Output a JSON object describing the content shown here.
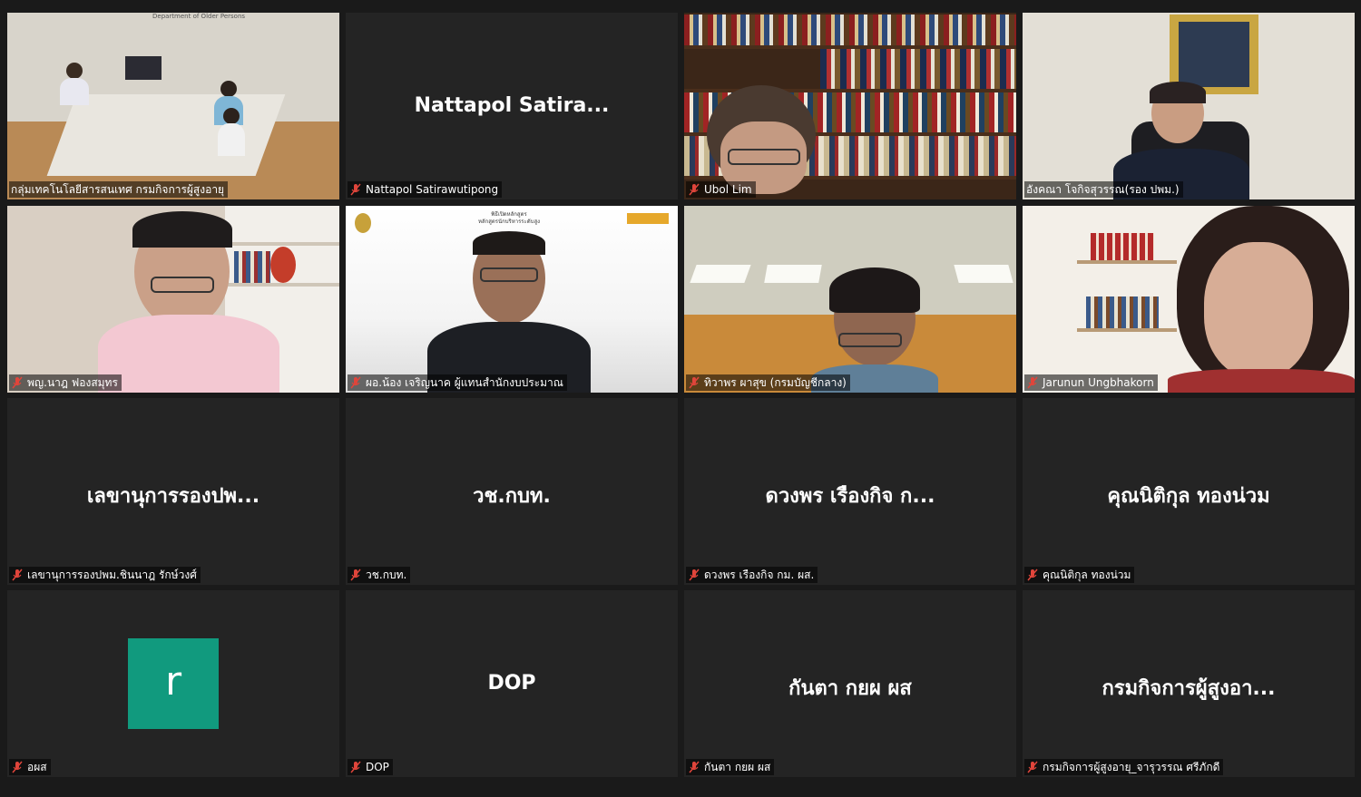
{
  "tiles": [
    {
      "name": "Video feed",
      "label": "กลุ่มเทคโนโลยีสารสนเทศ กรมกิจการผู้สูงอายุ",
      "type": "video",
      "scene": "meeting-room",
      "active": true,
      "caption_text": "Department of Older Persons"
    },
    {
      "name": "Nattapol  Satira...",
      "label": "Nattapol Satirawutipong",
      "type": "name"
    },
    {
      "name": "Video feed",
      "label": "Ubol Lim",
      "type": "video",
      "scene": "bookshelf"
    },
    {
      "name": "Video feed",
      "label": "อังคณา โจกิจสุวรรณ(รอง ปพม.)",
      "type": "video",
      "scene": "portrait-office"
    },
    {
      "name": "Video feed",
      "label": "พญ.นาฎ ฟองสมุทร",
      "type": "video",
      "scene": "home-shelf"
    },
    {
      "name": "Video feed",
      "label": "ผอ.น้อง เจริญนาค ผู้แทนสำนักงบประมาณ",
      "type": "video",
      "scene": "banner",
      "banner_text": [
        "พิธีเปิดหลักสูตร",
        "หลักสูตรนักบริหารระดับสูง"
      ]
    },
    {
      "name": "Video feed",
      "label": "ทิวาพร ผาสุข (กรมบัญชีกลาง)",
      "type": "video",
      "scene": "office-ceiling"
    },
    {
      "name": "Video feed",
      "label": "Jarunun Ungbhakorn",
      "type": "video",
      "scene": "home-red"
    },
    {
      "name": "เลขานุการรองปพ...",
      "label": "เลขานุการรองปพม.ชินนาฎ รักษ์วงศ์",
      "type": "name"
    },
    {
      "name": "วช.กบท.",
      "label": "วช.กบท.",
      "type": "name"
    },
    {
      "name": "ดวงพร เรืองกิจ ก...",
      "label": "ดวงพร เรืองกิจ กม. ผส.",
      "type": "name"
    },
    {
      "name": "คุณนิติกุล ทองน่วม",
      "label": "คุณนิติกุล ทองน่วม",
      "type": "name"
    },
    {
      "name": "r",
      "label": "อผส",
      "type": "avatar",
      "avatar_color": "#119a7e"
    },
    {
      "name": "DOP",
      "label": "DOP",
      "type": "name"
    },
    {
      "name": "กันตา กยผ ผส",
      "label": "กันตา กยผ ผส",
      "type": "name"
    },
    {
      "name": "กรมกิจการผู้สูงอา...",
      "label": "กรมกิจการผู้สูงอายุ_จารุวรรณ ศรีภักดี",
      "type": "name"
    }
  ],
  "colors": {
    "active_border": "#b6e56a",
    "mic_muted": "#e0453b",
    "tile_bg": "#242424",
    "background": "#1a1a1a"
  },
  "icons": {
    "muted": "mic-muted-icon"
  }
}
